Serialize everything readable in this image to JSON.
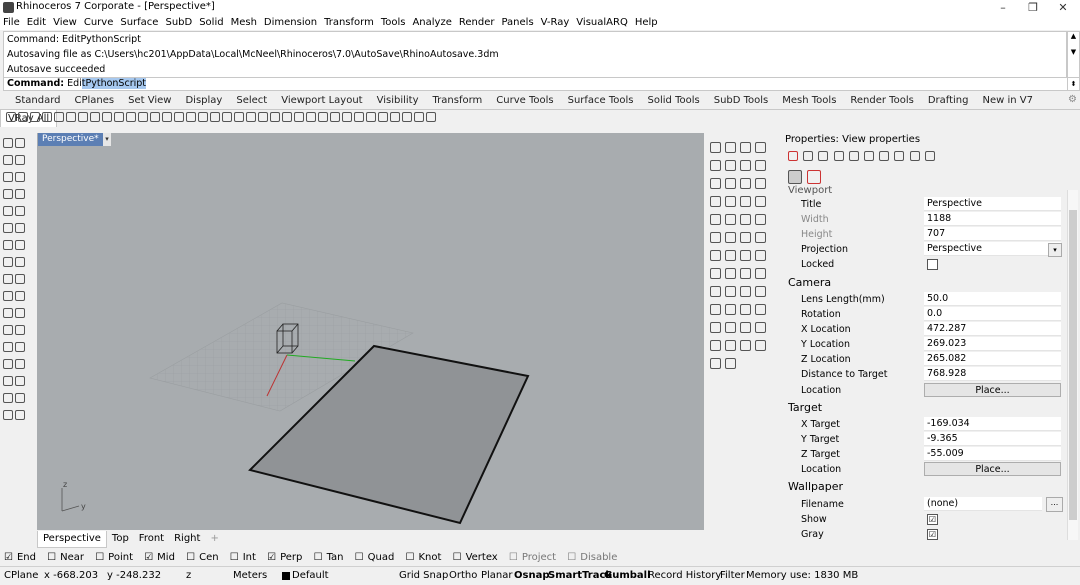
{
  "window": {
    "title": "Rhinoceros 7 Corporate - [Perspective*]",
    "controls": [
      "–",
      "❐",
      "✕"
    ]
  },
  "menu": [
    "File",
    "Edit",
    "View",
    "Curve",
    "Surface",
    "SubD",
    "Solid",
    "Mesh",
    "Dimension",
    "Transform",
    "Tools",
    "Analyze",
    "Render",
    "Panels",
    "V-Ray",
    "VisualARQ",
    "Help"
  ],
  "command_history": [
    "Command: EditPythonScript",
    "Autosaving file as C:\\Users\\hc201\\AppData\\Local\\McNeel\\Rhinoceros\\7.0\\AutoSave\\RhinoAutosave.3dm",
    "Autosave succeeded"
  ],
  "command_line": {
    "prompt": "Command:",
    "typed": " Edi",
    "autocomplete": "tPythonScript"
  },
  "toolbar_tabs": [
    "Standard",
    "CPlanes",
    "Set View",
    "Display",
    "Select",
    "Viewport Layout",
    "Visibility",
    "Transform",
    "Curve Tools",
    "Surface Tools",
    "Solid Tools",
    "SubD Tools",
    "Mesh Tools",
    "Render Tools",
    "Drafting",
    "New in V7",
    "VRay All"
  ],
  "active_toolbar_tab": "VRay All",
  "viewport": {
    "title": "Perspective*",
    "menu_icon": "▾",
    "axis_z": "z",
    "axis_y": "y"
  },
  "viewport_tabs": [
    "Perspective",
    "Top",
    "Front",
    "Right",
    "+"
  ],
  "properties": {
    "header": "Properties: View properties",
    "section_viewport": "Viewport",
    "viewport": [
      {
        "label": "Title",
        "value": "Perspective"
      },
      {
        "label": "Width",
        "value": "1188"
      },
      {
        "label": "Height",
        "value": "707"
      },
      {
        "label": "Projection",
        "value": "Perspective"
      },
      {
        "label": "Locked",
        "value": ""
      }
    ],
    "section_camera": "Camera",
    "camera": [
      {
        "label": "Lens Length(mm)",
        "value": "50.0"
      },
      {
        "label": "Rotation",
        "value": "0.0"
      },
      {
        "label": "X Location",
        "value": "472.287"
      },
      {
        "label": "Y Location",
        "value": "269.023"
      },
      {
        "label": "Z Location",
        "value": "265.082"
      },
      {
        "label": "Distance to Target",
        "value": "768.928"
      },
      {
        "label": "Location",
        "value": "Place..."
      }
    ],
    "section_target": "Target",
    "target": [
      {
        "label": "X Target",
        "value": "-169.034"
      },
      {
        "label": "Y Target",
        "value": "-9.365"
      },
      {
        "label": "Z Target",
        "value": "-55.009"
      },
      {
        "label": "Location",
        "value": "Place..."
      }
    ],
    "section_wallpaper": "Wallpaper",
    "wallpaper": [
      {
        "label": "Filename",
        "value": "(none)",
        "extra": "..."
      },
      {
        "label": "Show",
        "checked": "☑"
      },
      {
        "label": "Gray",
        "checked": "☑"
      }
    ]
  },
  "osnap": [
    {
      "label": "End",
      "checked": "☑"
    },
    {
      "label": "Near",
      "checked": "☐"
    },
    {
      "label": "Point",
      "checked": "☐"
    },
    {
      "label": "Mid",
      "checked": "☑"
    },
    {
      "label": "Cen",
      "checked": "☐"
    },
    {
      "label": "Int",
      "checked": "☐"
    },
    {
      "label": "Perp",
      "checked": "☑"
    },
    {
      "label": "Tan",
      "checked": "☐"
    },
    {
      "label": "Quad",
      "checked": "☐"
    },
    {
      "label": "Knot",
      "checked": "☐"
    },
    {
      "label": "Vertex",
      "checked": "☐"
    },
    {
      "label": "Project",
      "checked": "☐"
    },
    {
      "label": "Disable",
      "checked": "☐"
    }
  ],
  "status": {
    "cplane": "CPlane",
    "x": "x -668.203",
    "y": "y -248.232",
    "z": "z",
    "units": "Meters",
    "layer": "Default",
    "grid_snap": "Grid Snap",
    "ortho": "Ortho",
    "planar": "Planar",
    "osnap": "Osnap",
    "smarttrack": "SmartTrack",
    "gumball": "Gumball",
    "record_history": "Record History",
    "filter": "Filter",
    "memory": "Memory use: 1830 MB"
  }
}
